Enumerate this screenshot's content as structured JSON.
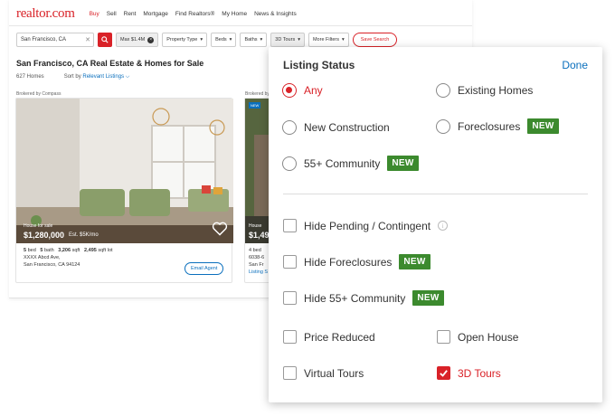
{
  "app": {
    "logo": "realtor.com",
    "nav": [
      "Buy",
      "Sell",
      "Rent",
      "Mortgage",
      "Find Realtors®",
      "My Home",
      "News & Insights"
    ],
    "nav_active": "Buy"
  },
  "filters": {
    "search_value": "San Francisco, CA",
    "price_chip": "Max $1.4M",
    "property_type": "Property Type",
    "beds": "Beds",
    "baths": "Baths",
    "tours": "3D Tours",
    "more": "More Filters",
    "save_search": "Save Search"
  },
  "results": {
    "title": "San Francisco, CA Real Estate & Homes for Sale",
    "count": "627 Homes",
    "sort_label": "Sort by",
    "sort_value": "Relevant Listings"
  },
  "cards": [
    {
      "brokered": "Brokered by Compass",
      "tag": "House for sale",
      "price": "$1,280,000",
      "est": "Est. $5K/mo",
      "beds": "5",
      "beds_label": "bed",
      "baths": "5",
      "baths_label": "bath",
      "sqft": "3,206",
      "sqft_label": "sqft",
      "lot": "2,495",
      "lot_label": "sqft lot",
      "address1": "XXXX Abcd Ave,",
      "address2": "San Francisco, CA 94124",
      "cta": "Email Agent"
    },
    {
      "brokered": "Brokered by",
      "badge": "NEW",
      "tag": "House",
      "price": "$1,49",
      "beds": "4 bed",
      "address1": "6038-6",
      "address2": "San Fr",
      "extra": "Listing S"
    }
  ],
  "panel": {
    "title": "Listing Status",
    "done": "Done",
    "radios": [
      {
        "label": "Any",
        "selected": true
      },
      {
        "label": "Existing Homes",
        "selected": false
      },
      {
        "label": "New Construction",
        "selected": false
      },
      {
        "label": "Foreclosures",
        "selected": false,
        "badge": "NEW"
      },
      {
        "label": "55+ Community",
        "selected": false,
        "badge": "NEW"
      }
    ],
    "checks": [
      {
        "label": "Hide Pending / Contingent",
        "checked": false,
        "info": "i"
      },
      {
        "label": "Hide Foreclosures",
        "checked": false,
        "badge": "NEW"
      },
      {
        "label": "Hide 55+ Community",
        "checked": false,
        "badge": "NEW"
      },
      {
        "label": "Price Reduced",
        "checked": false
      },
      {
        "label": "Open House",
        "checked": false
      },
      {
        "label": "Virtual Tours",
        "checked": false
      },
      {
        "label": "3D Tours",
        "checked": true
      }
    ]
  },
  "colors": {
    "brand_red": "#d92228",
    "link_blue": "#0a6fbd",
    "new_green": "#3c8a2e"
  }
}
